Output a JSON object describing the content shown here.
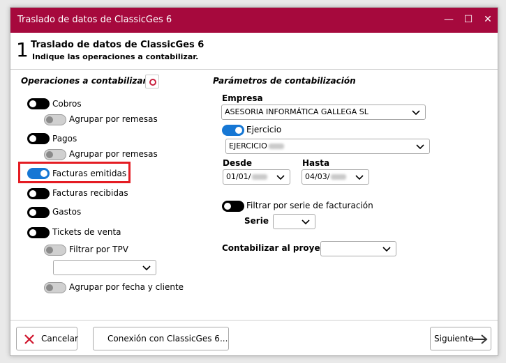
{
  "window": {
    "title": "Traslado de datos de ClassicGes 6",
    "controls": [
      "—",
      "☐",
      "✕"
    ]
  },
  "header": {
    "step": "1",
    "title": "Traslado de datos de ClassicGes 6",
    "subtitle": "Indique las operaciones a contabilizar."
  },
  "operaciones": {
    "title": "Operaciones a contabilizar",
    "items": [
      {
        "label": "Cobros",
        "state": "off"
      },
      {
        "label": "Agrupar por remesas",
        "state": "disabled"
      },
      {
        "label": "Pagos",
        "state": "off"
      },
      {
        "label": "Agrupar por remesas",
        "state": "disabled"
      },
      {
        "label": "Facturas emitidas",
        "state": "on"
      },
      {
        "label": "Facturas recibidas",
        "state": "off"
      },
      {
        "label": "Gastos",
        "state": "off"
      },
      {
        "label": "Tickets de venta",
        "state": "off"
      },
      {
        "label": "Filtrar por TPV",
        "state": "disabled"
      },
      {
        "label": "Agrupar por fecha y cliente",
        "state": "disabled"
      }
    ],
    "tpv_value": ""
  },
  "parametros": {
    "title": "Parámetros de contabilización",
    "empresa_label": "Empresa",
    "empresa_value": "ASESORIA INFORMÁTICA GALLEGA SL",
    "ejercicio_label": "Ejercicio",
    "ejercicio_value": "EJERCICIO",
    "desde_label": "Desde",
    "desde_value": "01/01/",
    "hasta_label": "Hasta",
    "hasta_value": "04/03/",
    "filtrar_serie_label": "Filtrar por serie de facturación",
    "serie_label": "Serie",
    "serie_value": "",
    "proyecto_label": "Contabilizar al proyecto",
    "proyecto_value": ""
  },
  "footer": {
    "cancel": "Cancelar",
    "connection": "Conexión con ClassicGes 6...",
    "next": "Siguiente"
  },
  "colors": {
    "titlebar": "#a6093d",
    "toggle_on": "#1677d4",
    "highlight": "#e41c23"
  }
}
